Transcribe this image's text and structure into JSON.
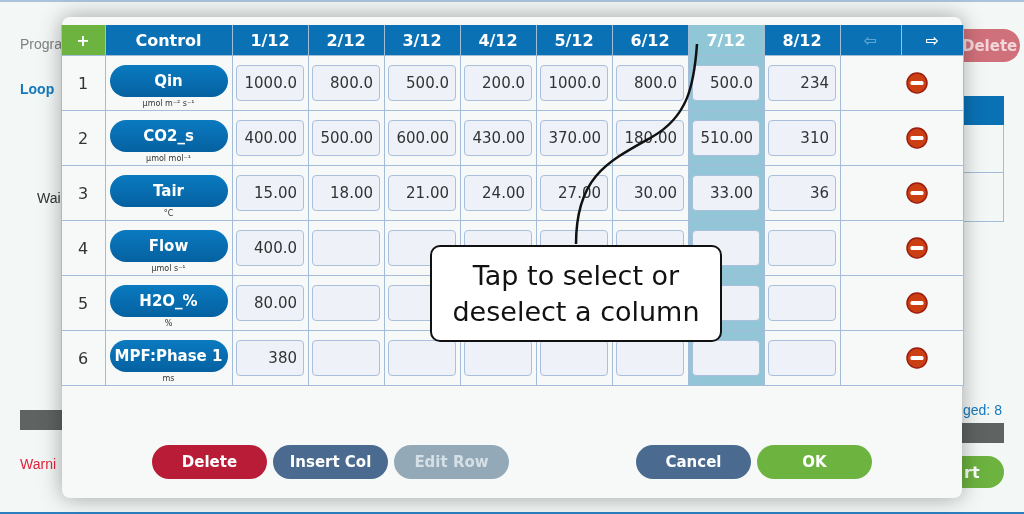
{
  "page": {
    "program_fragment": "Progra",
    "loop_fragment": "Loop",
    "wait_fragment": "Wai",
    "warning_fragment": "Warni",
    "delete_button": "Delete",
    "logged_fragment": "ged: 8",
    "start_button_fragment": "rt"
  },
  "dialog": {
    "add_button": "+",
    "control_header": "Control",
    "columns": [
      {
        "label": "1/12",
        "selected": false
      },
      {
        "label": "2/12",
        "selected": false
      },
      {
        "label": "3/12",
        "selected": false
      },
      {
        "label": "4/12",
        "selected": false
      },
      {
        "label": "5/12",
        "selected": false
      },
      {
        "label": "6/12",
        "selected": false
      },
      {
        "label": "7/12",
        "selected": true
      },
      {
        "label": "8/12",
        "selected": false
      }
    ],
    "prev_arrow": {
      "label": "⇦",
      "disabled": true
    },
    "next_arrow": {
      "label": "⇨",
      "disabled": false
    },
    "rows": [
      {
        "index": "1",
        "control": "Qin",
        "unit": "µmol m⁻² s⁻¹",
        "values": [
          "1000.0",
          "800.0",
          "500.0",
          "200.0",
          "1000.0",
          "800.0",
          "500.0",
          "234"
        ]
      },
      {
        "index": "2",
        "control": "CO2_s",
        "unit": "µmol mol⁻¹",
        "values": [
          "400.00",
          "500.00",
          "600.00",
          "430.00",
          "370.00",
          "180.00",
          "510.00",
          "310"
        ]
      },
      {
        "index": "3",
        "control": "Tair",
        "unit": "°C",
        "values": [
          "15.00",
          "18.00",
          "21.00",
          "24.00",
          "27.00",
          "30.00",
          "33.00",
          "36"
        ]
      },
      {
        "index": "4",
        "control": "Flow",
        "unit": "µmol s⁻¹",
        "values": [
          "400.0"
        ]
      },
      {
        "index": "5",
        "control": "H2O_%",
        "unit": "%",
        "values": [
          "80.00"
        ]
      },
      {
        "index": "6",
        "control": "MPF:Phase 1",
        "unit": "ms",
        "values": [
          "380"
        ]
      }
    ],
    "buttons": [
      {
        "label": "Delete",
        "kind": "danger",
        "disabled": false
      },
      {
        "label": "Insert Col",
        "kind": "secondary",
        "disabled": false
      },
      {
        "label": "Edit Row",
        "kind": "secondary",
        "disabled": true
      },
      {
        "label": "Cancel",
        "kind": "secondary",
        "disabled": false
      },
      {
        "label": "OK",
        "kind": "primary",
        "disabled": false
      }
    ]
  },
  "callout": {
    "text": "Tap to select or deselect a column"
  }
}
